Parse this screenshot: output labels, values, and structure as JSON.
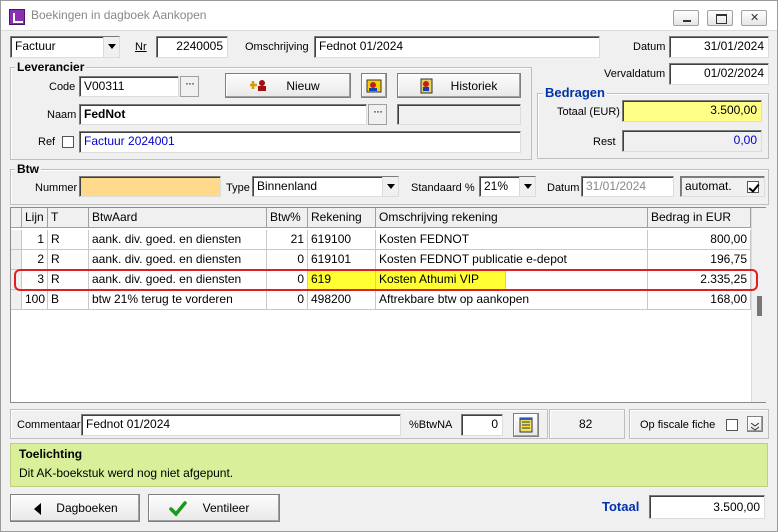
{
  "window": {
    "title": "Boekingen in dagboek Aankopen"
  },
  "header": {
    "doc_type": "Factuur",
    "nr_label": "Nr",
    "nr": "2240005",
    "omschrijving_label": "Omschrijving",
    "omschrijving": "Fednot 01/2024",
    "datum_label": "Datum",
    "datum": "31/01/2024",
    "vervaldatum_label": "Vervaldatum",
    "vervaldatum": "01/02/2024"
  },
  "leverancier": {
    "title": "Leverancier",
    "code_label": "Code",
    "code": "V00311",
    "naam_label": "Naam",
    "naam": "FedNot",
    "ref_label": "Ref",
    "ref": "Factuur 2024001",
    "nieuw_label": "Nieuw",
    "historiek_label": "Historiek"
  },
  "bedragen": {
    "title": "Bedragen",
    "totaal_label": "Totaal (EUR)",
    "totaal": "3.500,00",
    "rest_label": "Rest",
    "rest": "0,00"
  },
  "btw": {
    "title": "Btw",
    "nummer_label": "Nummer",
    "nummer": "",
    "type_label": "Type",
    "type": "Binnenland",
    "standaard_label": "Standaard %",
    "standaard": "21%",
    "datum_label": "Datum",
    "datum": "31/01/2024",
    "automat_label": "automat."
  },
  "grid": {
    "columns": [
      "Lijn",
      "T",
      "BtwAard",
      "Btw%",
      "Rekening",
      "Omschrijving rekening",
      "Bedrag in EUR"
    ],
    "rows": [
      {
        "lijn": "1",
        "t": "R",
        "btwaard": "aank. div. goed. en diensten",
        "btw": "21",
        "rekening": "619100",
        "omschrijving": "Kosten FEDNOT",
        "bedrag": "800,00"
      },
      {
        "lijn": "2",
        "t": "R",
        "btwaard": "aank. div. goed. en diensten",
        "btw": "0",
        "rekening": "619101",
        "omschrijving": "Kosten FEDNOT publicatie e-depot",
        "bedrag": "196,75"
      },
      {
        "lijn": "3",
        "t": "R",
        "btwaard": "aank. div. goed. en diensten",
        "btw": "0",
        "rekening": "619",
        "omschrijving": "Kosten Athumi VIP",
        "bedrag": "2.335,25"
      },
      {
        "lijn": "100",
        "t": "B",
        "btwaard": "btw 21% terug te vorderen",
        "btw": "0",
        "rekening": "498200",
        "omschrijving": "Aftrekbare btw op aankopen",
        "bedrag": "168,00"
      }
    ]
  },
  "footer": {
    "commentaar_label": "Commentaar",
    "commentaar": "Fednot 01/2024",
    "btwna_label": "%BtwNA",
    "btwna": "0",
    "count": "82",
    "fiscale_label": "Op fiscale fiche"
  },
  "toelichting": {
    "title": "Toelichting",
    "text": "Dit AK-boekstuk werd nog niet afgepunt."
  },
  "bottom": {
    "dagboeken_label": "Dagboeken",
    "ventileer_label": "Ventileer",
    "totaal_label": "Totaal",
    "totaal": "3.500,00"
  },
  "colors": {
    "highlight": "#ffff33",
    "notice_bg": "#d9ef9a",
    "title_blue": "#0033aa",
    "marker_red": "#e02020"
  }
}
